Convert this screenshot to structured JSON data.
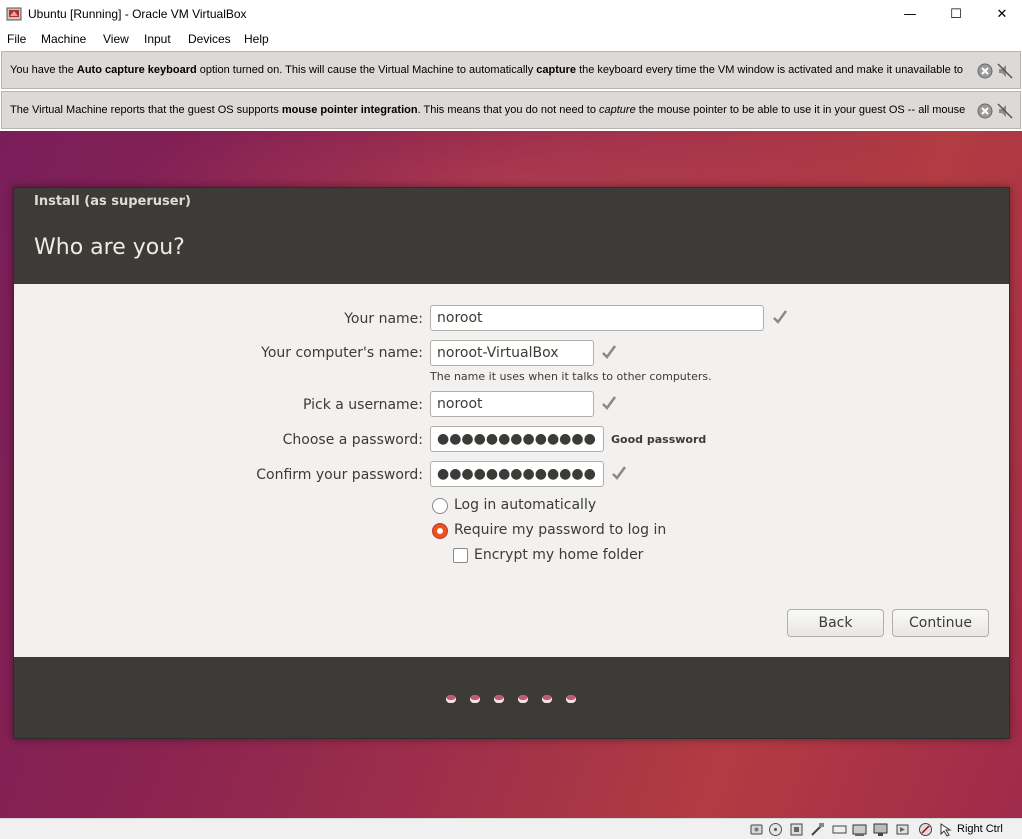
{
  "window": {
    "title": "Ubuntu [Running] - Oracle VM VirtualBox",
    "minimize": "—",
    "maximize": "☐",
    "close": "✕"
  },
  "menu": [
    "File",
    "Machine",
    "View",
    "Input",
    "Devices",
    "Help"
  ],
  "notifications": [
    {
      "pre": "You have the ",
      "b1": "Auto capture keyboard",
      "mid": " option turned on. This will cause the Virtual Machine to automatically ",
      "b2": "capture",
      "post": " the keyboard every time the VM window is activated and make it unavailable to"
    },
    {
      "pre": "The Virtual Machine reports that the guest OS supports ",
      "b1": "mouse pointer integration",
      "mid": ". This means that you do not need to ",
      "i1": "capture",
      "post": " the mouse pointer to be able to use it in your guest OS -- all mouse"
    }
  ],
  "installer": {
    "window_title": "Install (as superuser)",
    "heading": "Who are you?",
    "fields": {
      "name_label": "Your name:",
      "name_value": "noroot",
      "computer_label": "Your computer's name:",
      "computer_value": "noroot-VirtualBox",
      "computer_hint": "The name it uses when it talks to other computers.",
      "username_label": "Pick a username:",
      "username_value": "noroot",
      "password_label": "Choose a password:",
      "password_value": "●●●●●●●●●●●●●",
      "password_strength": "Good password",
      "confirm_label": "Confirm your password:",
      "confirm_value": "●●●●●●●●●●●●●"
    },
    "options": {
      "auto_login": "Log in automatically",
      "require_password": "Require my password to log in",
      "encrypt_home": "Encrypt my home folder",
      "selected": "require_password",
      "encrypt_checked": false
    },
    "buttons": {
      "back": "Back",
      "continue": "Continue"
    },
    "progress_dots": 6
  },
  "statusbar": {
    "host_key": "Right Ctrl",
    "icons": [
      "hard-disk-icon",
      "optical-drive-icon",
      "audio-icon",
      "network-icon",
      "usb-icon",
      "shared-folders-icon",
      "display-icon",
      "video-capture-icon",
      "cpu-icon",
      "mouse-integration-icon",
      "host-key-icon"
    ]
  },
  "colors": {
    "accent": "#e95420",
    "installer_dark": "#3c3b37",
    "installer_bg": "#f2f1f0"
  }
}
